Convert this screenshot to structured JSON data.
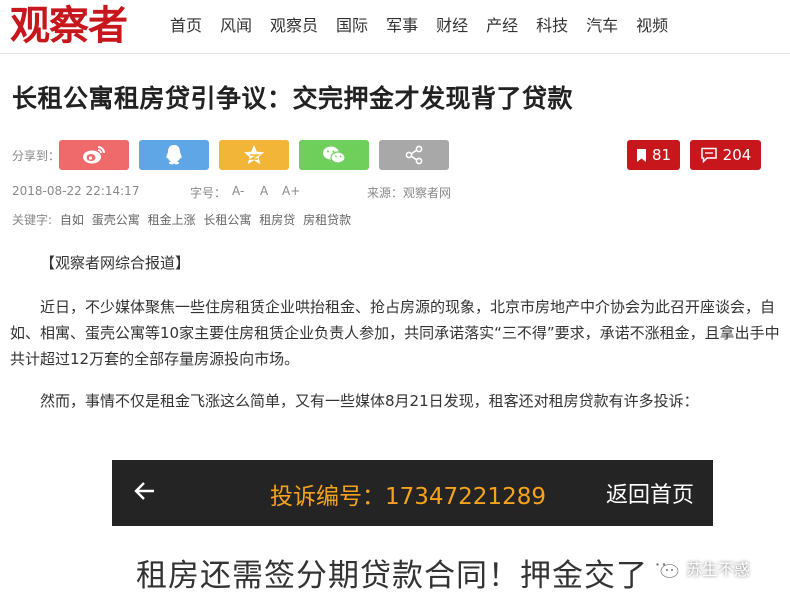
{
  "site": {
    "logo": "观察者",
    "nav": [
      "首页",
      "风闻",
      "观察员",
      "国际",
      "军事",
      "财经",
      "产经",
      "科技",
      "汽车",
      "视频"
    ]
  },
  "article": {
    "title": "长租公寓租房贷引争议：交完押金才发现背了贷款",
    "share_label": "分享到：",
    "bookmark_count": "81",
    "comment_count": "204",
    "datetime": "2018-08-22 22:14:17",
    "font_label": "字号：",
    "font_small": "A-",
    "font_mid": "A",
    "font_large": "A+",
    "source": "来源：观察者网",
    "keywords_label": "关键字:",
    "keywords": [
      "自如",
      "蛋壳公寓",
      "租金上涨",
      "长租公寓",
      "租房贷",
      "房租贷款"
    ],
    "paragraphs": [
      "【观察者网综合报道】",
      "近日，不少媒体聚焦一些住房租赁企业哄抬租金、抢占房源的现象，北京市房地产中介协会为此召开座谈会，自如、相寓、蛋壳公寓等10家主要住房租赁企业负责人参加，共同承诺落实“三不得”要求，承诺不涨租金，且拿出手中共计超过12万套的全部存量房源投向市场。",
      "然而，事情不仅是租金飞涨这么简单，又有一些媒体8月21日发现，租客还对租房贷款有许多投诉："
    ]
  },
  "embedded_screenshot": {
    "complaint_label": "投诉编号：17347221289",
    "home_label": "返回首页",
    "headline": "租房还需签分期贷款合同！押金交了"
  },
  "watermark": "苏生不惑",
  "colors": {
    "brand_red": "#c8161d",
    "weibo": "#ef6b6b",
    "qq": "#5fa6e6",
    "qzone": "#f2b537",
    "wechat": "#6fcf5b",
    "more": "#a8a8a8",
    "complaint_orange": "#f5a21c"
  },
  "icons": [
    "weibo-icon",
    "qq-icon",
    "qzone-star-icon",
    "wechat-icon",
    "share-more-icon",
    "bookmark-icon",
    "comment-icon",
    "back-arrow-icon",
    "wechat-watermark-icon"
  ]
}
